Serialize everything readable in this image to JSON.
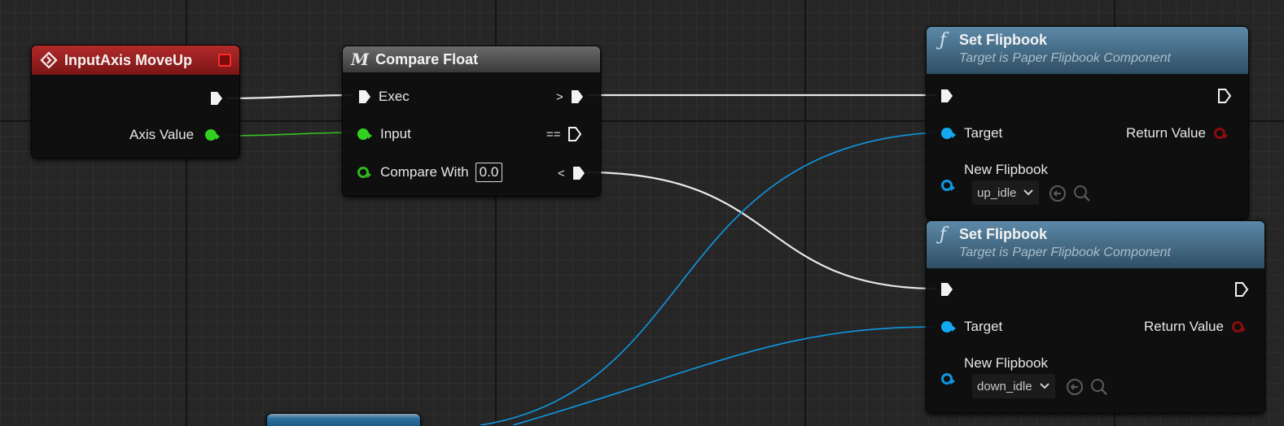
{
  "nodes": {
    "input_axis": {
      "title": "InputAxis MoveUp",
      "pins": {
        "axis_value": "Axis Value"
      },
      "header_color": "#9b1f1f"
    },
    "compare_float": {
      "title": "Compare Float",
      "title_icon": "M",
      "pins": {
        "exec": "Exec",
        "input": "Input",
        "compare_with": "Compare With",
        "compare_with_value": "0.0",
        "op_greater": ">",
        "op_equal": "==",
        "op_less": "<"
      }
    },
    "set_flipbook_1": {
      "title": "Set Flipbook",
      "subtitle": "Target is Paper Flipbook Component",
      "title_icon": "ƒ",
      "pins": {
        "target": "Target",
        "return_value": "Return Value",
        "new_flipbook": "New Flipbook",
        "flipbook_value": "up_idle"
      }
    },
    "set_flipbook_2": {
      "title": "Set Flipbook",
      "subtitle": "Target is Paper Flipbook Component",
      "title_icon": "ƒ",
      "pins": {
        "target": "Target",
        "return_value": "Return Value",
        "new_flipbook": "New Flipbook",
        "flipbook_value": "down_idle"
      }
    }
  },
  "colors": {
    "exec_wire": "#e8e8e8",
    "float_wire": "#34c41f",
    "object_wire": "#0f98e0",
    "function_header": "#4d7896"
  },
  "icons": {
    "event": "event-diamond-icon",
    "close": "delegate-square-icon",
    "function": "function-f-icon",
    "macro": "macro-m-icon",
    "use_selected": "use-selected-arrow-icon",
    "browse": "browse-search-icon",
    "dropdown": "chevron-down-icon"
  }
}
